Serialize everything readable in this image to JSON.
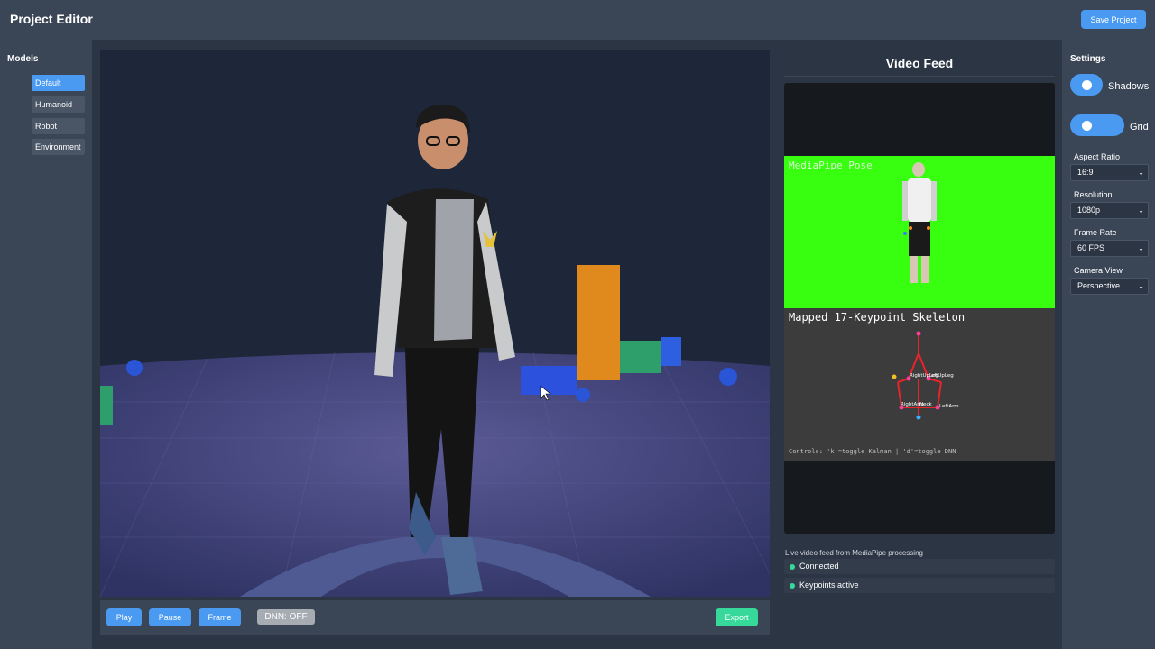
{
  "header": {
    "title": "Project Editor",
    "save_label": "Save Project"
  },
  "sidebar": {
    "title": "Models",
    "items": [
      {
        "label": "Default",
        "active": true
      },
      {
        "label": "Humanoid",
        "active": false
      },
      {
        "label": "Robot",
        "active": false
      },
      {
        "label": "Environment",
        "active": false
      }
    ]
  },
  "toolbar": {
    "play_label": "Play",
    "pause_label": "Pause",
    "frame_label": "Frame",
    "dnn_label": "DNN: OFF",
    "export_label": "Export"
  },
  "video": {
    "title": "Video Feed",
    "pose_label": "MediaPipe Pose",
    "skeleton_title": "Mapped 17-Keypoint Skeleton",
    "keypoint_labels": [
      "RightUpLeg",
      "LeftUpLeg",
      "RightArm",
      "Neck",
      "LeftArm"
    ],
    "controls_text": "Controls: 'k'=toggle Kalman | 'd'=toggle DNN",
    "caption": "Live video feed from MediaPipe processing",
    "status": [
      {
        "label": "Connected"
      },
      {
        "label": "Keypoints active"
      }
    ]
  },
  "settings": {
    "title": "Settings",
    "toggles": [
      {
        "label": "Shadows",
        "on": true
      },
      {
        "label": "Grid",
        "on": true
      }
    ],
    "fields": [
      {
        "label": "Aspect Ratio",
        "value": "16:9"
      },
      {
        "label": "Resolution",
        "value": "1080p"
      },
      {
        "label": "Frame Rate",
        "value": "60 FPS"
      },
      {
        "label": "Camera View",
        "value": "Perspective"
      }
    ]
  },
  "colors": {
    "accent": "#4a9af2",
    "success": "#36d99a",
    "chroma_green": "#38ff0f"
  }
}
